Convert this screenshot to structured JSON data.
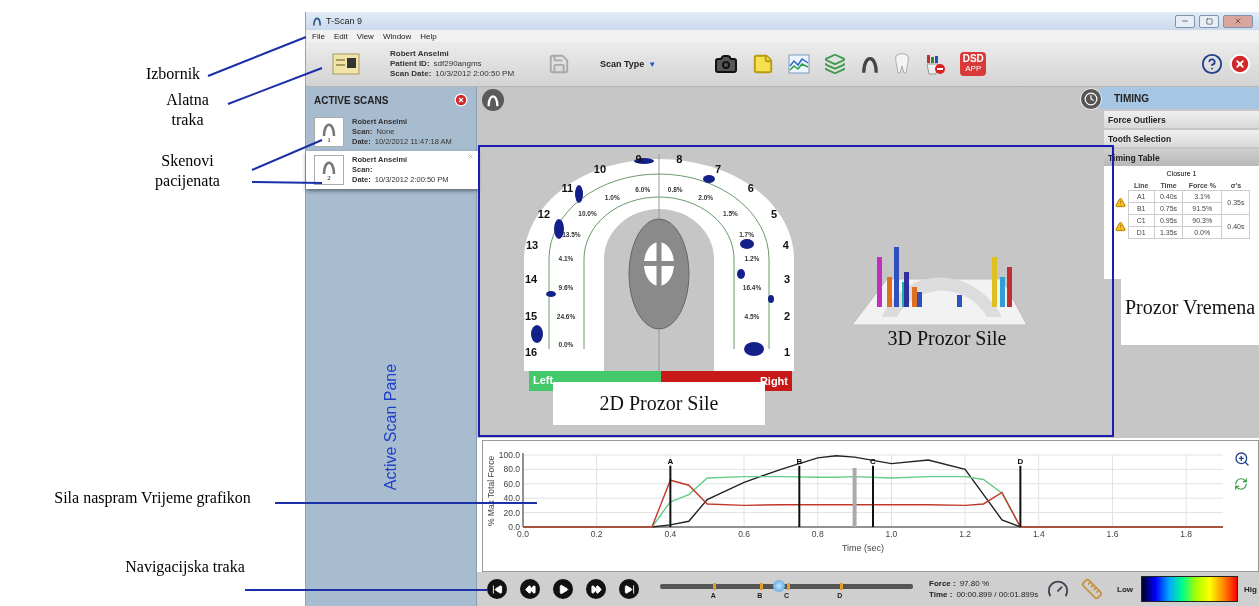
{
  "window": {
    "title": "T-Scan 9"
  },
  "menu": [
    "File",
    "Edit",
    "View",
    "Window",
    "Help"
  ],
  "toolbar": {
    "patient": {
      "name": "Robert Anselmi",
      "id_label": "Patient ID:",
      "id": "sdf290angms",
      "date_label": "Scan Date:",
      "date": "10/3/2012 2:00:50 PM"
    },
    "scan_type": {
      "label": "Scan Type",
      "caret": "▼"
    },
    "app_badge": {
      "top": "DSD",
      "bottom": "APP"
    }
  },
  "active_scans": {
    "title": "ACTIVE SCANS",
    "pane_label": "Active Scan Pane",
    "items": [
      {
        "number": "1",
        "name": "Robert Anselmi",
        "scan_label": "Scan:",
        "scan": "None",
        "date_label": "Date:",
        "date": "10/2/2012 11:47:18 AM",
        "selected": false
      },
      {
        "number": "2",
        "name": "Robert Anselmi",
        "scan_label": "Scan:",
        "date_label": "Date:",
        "date": "10/3/2012 2:00:50 PM",
        "selected": true
      }
    ]
  },
  "force_view": {
    "teeth_left": [
      {
        "number": "9",
        "force": "6.0%"
      },
      {
        "number": "10",
        "force": "1.0%"
      },
      {
        "number": "11",
        "force": "10.0%"
      },
      {
        "number": "12",
        "force": "13.5%"
      },
      {
        "number": "13",
        "force": "4.1%"
      },
      {
        "number": "14",
        "force": "9.6%"
      },
      {
        "number": "15",
        "force": "24.6%"
      },
      {
        "number": "16",
        "force": "0.0%"
      }
    ],
    "teeth_right": [
      {
        "number": "8",
        "force": "0.8%"
      },
      {
        "number": "7",
        "force": "2.0%"
      },
      {
        "number": "6",
        "force": "1.5%"
      },
      {
        "number": "5",
        "force": "1.7%"
      },
      {
        "number": "4",
        "force": "1.2%"
      },
      {
        "number": "3",
        "force": "16.4%"
      },
      {
        "number": "2",
        "force": "4.5%"
      },
      {
        "number": "1"
      }
    ],
    "balance": {
      "left_label": "Left",
      "right_label": "Right",
      "level": 0.5
    }
  },
  "timing": {
    "title": "TIMING",
    "sections": [
      {
        "label": "Force Outliers",
        "expanded": false
      },
      {
        "label": "Tooth Selection",
        "expanded": false
      },
      {
        "label": "Timing Table",
        "expanded": true
      }
    ],
    "table": {
      "title": "Closure 1",
      "columns": [
        "Line",
        "Time",
        "Force %",
        "σ's"
      ],
      "groups": [
        {
          "warning": true,
          "sigma": "0.35s",
          "rows": [
            [
              "A1",
              "0.40s",
              "3.1%"
            ],
            [
              "B1",
              "0.75s",
              "91.5%"
            ]
          ]
        },
        {
          "warning": true,
          "sigma": "0.40s",
          "rows": [
            [
              "C1",
              "0.95s",
              "90.3%"
            ],
            [
              "D1",
              "1.35s",
              "0.0%"
            ]
          ]
        }
      ]
    }
  },
  "chart": {
    "chart_data": {
      "type": "line",
      "xlabel": "Time (sec)",
      "ylabel": "% Max Total Force",
      "x": [
        0,
        0.35,
        0.4,
        0.45,
        0.5,
        0.6,
        0.7,
        0.8,
        0.85,
        0.9,
        1.0,
        1.1,
        1.2,
        1.25,
        1.3,
        1.35,
        1.9
      ],
      "series": [
        {
          "color": "#222222",
          "values": [
            0,
            0,
            3,
            8,
            38,
            62,
            80,
            96,
            99,
            97,
            88,
            93,
            80,
            45,
            10,
            0,
            0
          ]
        },
        {
          "color": "#66cc88",
          "values": [
            0,
            0,
            35,
            45,
            68,
            70,
            70,
            69,
            69,
            70,
            68,
            70,
            70,
            66,
            47,
            0,
            0
          ]
        },
        {
          "color": "#c0392b",
          "values": [
            0,
            0,
            65,
            58,
            32,
            30,
            31,
            31,
            31,
            31,
            31,
            31,
            30,
            32,
            48,
            0,
            0
          ]
        }
      ],
      "xlim": [
        0,
        1.9
      ],
      "ylim": [
        0,
        100
      ],
      "xticks": [
        {
          "value": 0,
          "label": "0.0"
        },
        {
          "value": 0.2,
          "label": "0.2"
        },
        {
          "value": 0.4,
          "label": "0.4"
        },
        {
          "value": 0.6,
          "label": "0.6"
        },
        {
          "value": 0.8,
          "label": "0.8"
        },
        {
          "value": 1.0,
          "label": "1.0"
        },
        {
          "value": 1.2,
          "label": "1.2"
        },
        {
          "value": 1.4,
          "label": "1.4"
        },
        {
          "value": 1.6,
          "label": "1.6"
        },
        {
          "value": 1.8,
          "label": "1.8"
        }
      ],
      "yticks": [
        {
          "value": 0,
          "label": "0.0"
        },
        {
          "value": 20,
          "label": "20.0"
        },
        {
          "value": 40,
          "label": "40.0"
        },
        {
          "value": 60,
          "label": "60.0"
        },
        {
          "value": 80,
          "label": "80.0"
        },
        {
          "value": 100,
          "label": "100.0"
        }
      ],
      "grid": true,
      "ref_lines": [
        {
          "axis": "x",
          "value": 0.4,
          "label": "A"
        },
        {
          "axis": "x",
          "value": 0.75,
          "label": "B"
        },
        {
          "axis": "x",
          "value": 0.9
        },
        {
          "axis": "x",
          "value": 0.95,
          "label": "C"
        },
        {
          "axis": "x",
          "value": 1.35,
          "label": "D"
        }
      ]
    }
  },
  "navigation": {
    "slider": {
      "level": 0.47,
      "markers": [
        "A",
        "B",
        "C",
        "D"
      ]
    },
    "force_label": "Force :",
    "force_value": "97.80 %",
    "time_label": "Time :",
    "time_value": "00:00.899 / 00:01.899s",
    "legend": {
      "low": "Low",
      "high": "Hig"
    }
  },
  "annotations": [
    {
      "kind": "menu",
      "text": "Izbornik"
    },
    {
      "kind": "toolbar",
      "text": "Alatna traka"
    },
    {
      "kind": "scans",
      "text": "Skenovi pacijenata"
    },
    {
      "kind": "chart",
      "text": "Sila naspram Vrijeme grafikon"
    },
    {
      "kind": "navigation",
      "text": "Navigacijska traka"
    }
  ],
  "overlay_labels": [
    {
      "kind": "force2d",
      "text": "2D Prozor Sile"
    },
    {
      "kind": "force3d",
      "text": "3D Prozor Sile"
    },
    {
      "kind": "timing",
      "text": "Prozor Vremena"
    }
  ]
}
